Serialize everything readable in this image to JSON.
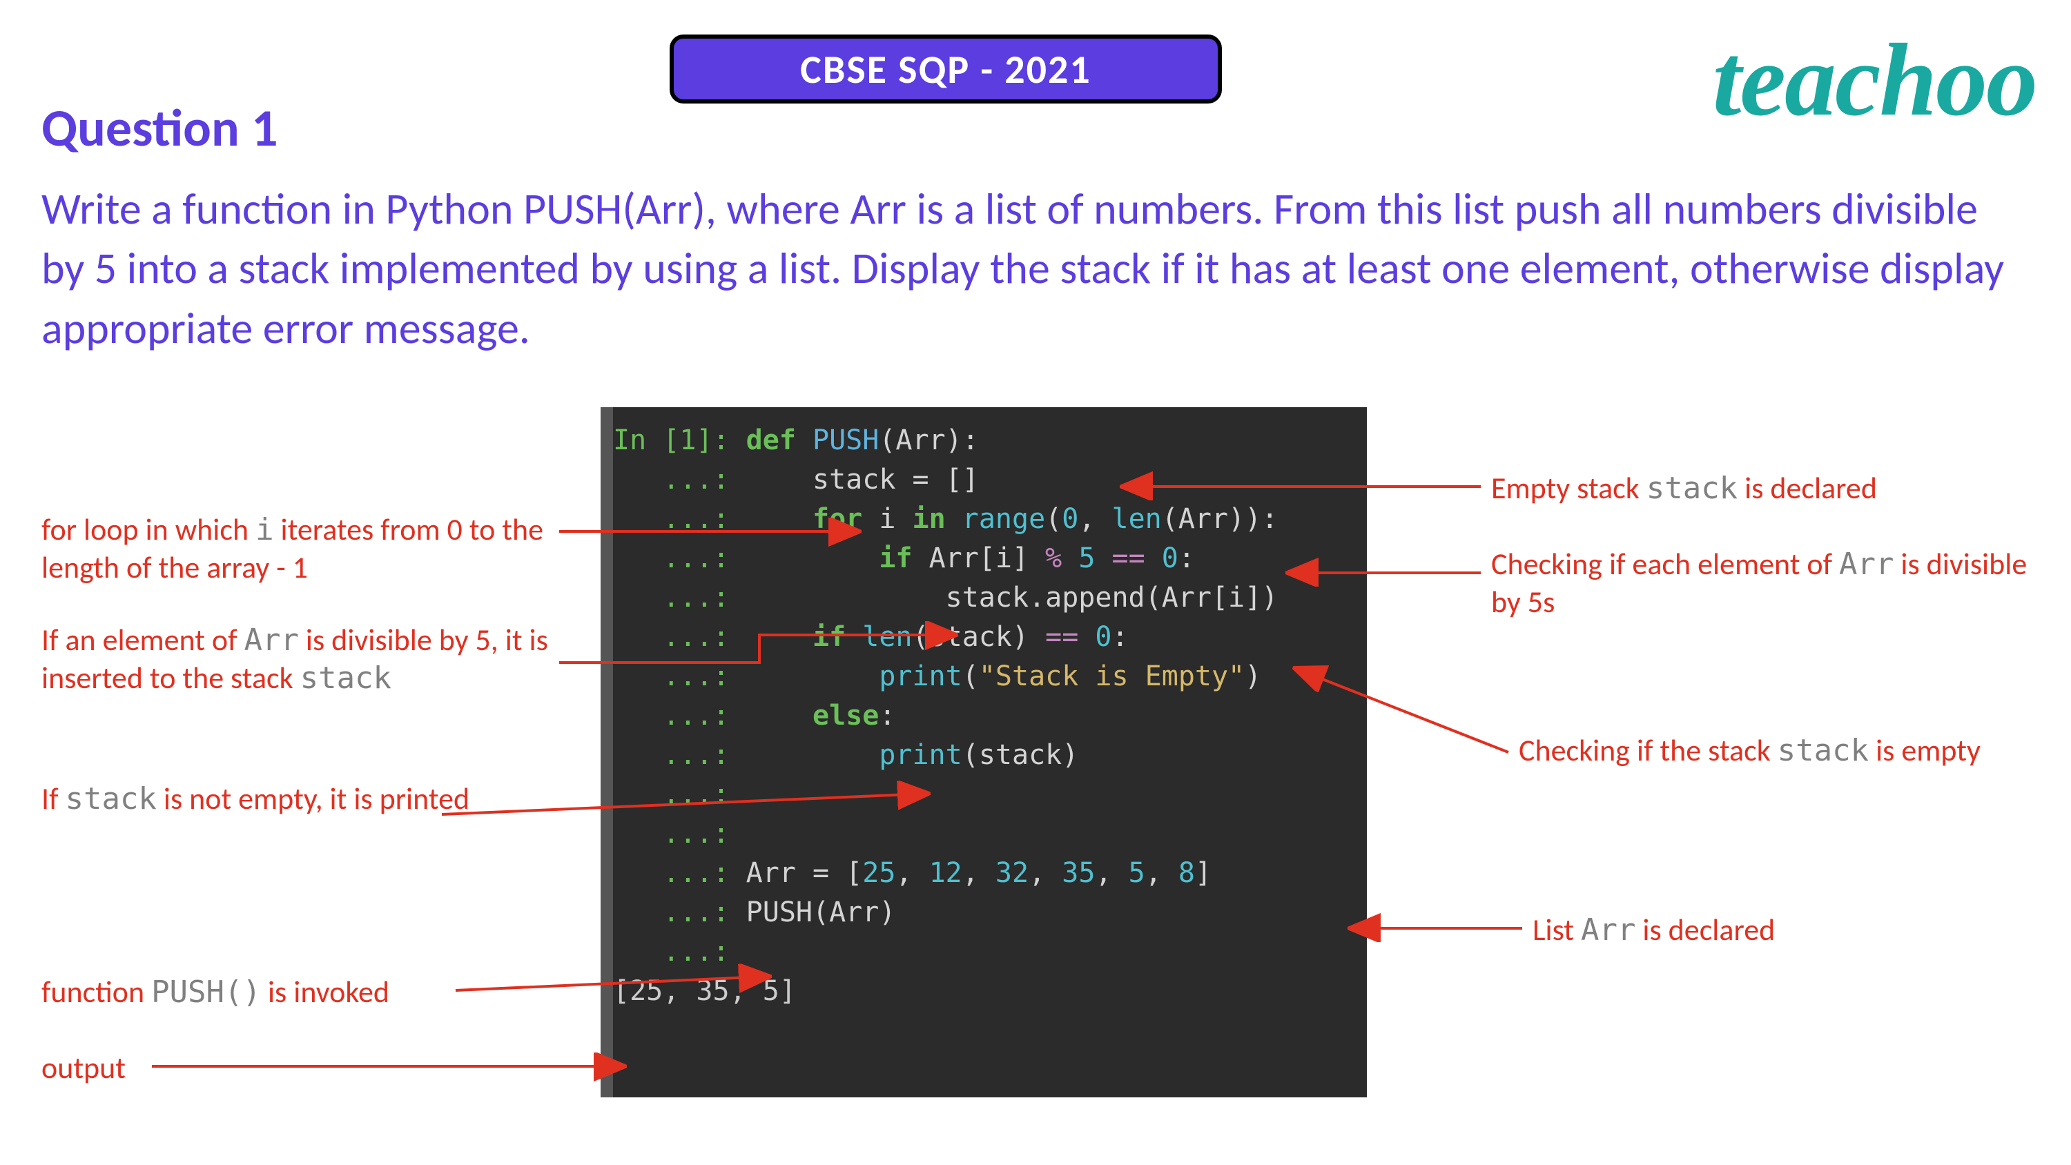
{
  "badge": "CBSE SQP - 2021",
  "logo": "teachoo",
  "question_title": "Question 1",
  "question_body": "Write a function in Python PUSH(Arr), where Arr  is a list of numbers. From this list push all numbers divisible by 5 into a stack implemented by  using a list. Display the stack if it has at least one  element, otherwise display appropriate error message.",
  "code": {
    "l1_prompt": "In [1]: ",
    "l1_def": "def ",
    "l1_name": "PUSH",
    "l1_rest": "(Arr):",
    "dots": "   ...: ",
    "l2": "    stack = []",
    "l3_a": "    ",
    "l3_for": "for ",
    "l3_b": "i ",
    "l3_in": "in ",
    "l3_range": "range",
    "l3_c": "(",
    "l3_zero": "0",
    "l3_d": ", ",
    "l3_len": "len",
    "l3_e": "(Arr)):",
    "l4_a": "        ",
    "l4_if": "if ",
    "l4_b": "Arr[i] ",
    "l4_mod": "% ",
    "l4_five": "5 ",
    "l4_eq": "== ",
    "l4_zero": "0",
    "l4_c": ":",
    "l5_a": "            stack.append(Arr[i])",
    "l6_a": "    ",
    "l6_if": "if ",
    "l6_len": "len",
    "l6_b": "(stack) ",
    "l6_eq": "== ",
    "l6_zero": "0",
    "l6_c": ":",
    "l7_a": "        ",
    "l7_print": "print",
    "l7_b": "(",
    "l7_str": "\"Stack is Empty\"",
    "l7_c": ")",
    "l8_a": "    ",
    "l8_else": "else",
    "l8_b": ":",
    "l9_a": "        ",
    "l9_print": "print",
    "l9_b": "(stack)",
    "l12_a": "Arr = [",
    "l12_n1": "25",
    "l12_s": ", ",
    "l12_n2": "12",
    "l12_n3": "32",
    "l12_n4": "35",
    "l12_n5": "5",
    "l12_n6": "8",
    "l12_b": "]",
    "l13": "PUSH(Arr)",
    "out": "[25, 35, 5]"
  },
  "annot": {
    "left1a": "for loop in which ",
    "left1m": "i",
    "left1b": " iterates from 0 to the length of the array - 1",
    "left2a": "If an element of ",
    "left2m": "Arr",
    "left2b": " is divisible by 5, it is inserted to the stack ",
    "left2m2": "stack",
    "left3a": "If ",
    "left3m": "stack",
    "left3b": " is not empty, it is printed",
    "left4a": "function ",
    "left4m": "PUSH()",
    "left4b": "  is invoked",
    "left5": "output",
    "right1a": "Empty stack ",
    "right1m": "stack",
    "right1b": " is declared",
    "right2a": "Checking if each element of ",
    "right2m": "Arr",
    "right2b": " is divisible by 5s",
    "right3a": "Checking if the stack ",
    "right3m": "stack",
    "right3b": " is empty",
    "right4a": "List ",
    "right4m": "Arr",
    "right4b": "  is declared"
  }
}
